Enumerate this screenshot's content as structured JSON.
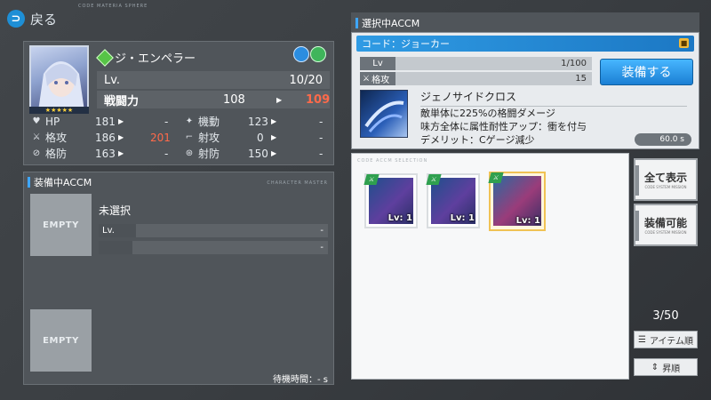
{
  "header": {
    "back_label": "戻る",
    "back_icon": "back-arrow-icon",
    "sub_caption": "CODE MATERIA SPHERE"
  },
  "character": {
    "name": "ジ・エンペラー",
    "stars": "★★★★★",
    "level_label": "Lv.",
    "level": "10/20",
    "power_label": "戦闘力",
    "power_current": "108",
    "power_new": "109",
    "arrow": "▶",
    "stats_left": [
      {
        "icon": "heart-icon",
        "label": "HP",
        "value": "181",
        "new": "-"
      },
      {
        "icon": "sword-icon",
        "label": "格攻",
        "value": "186",
        "new": "201"
      },
      {
        "icon": "shield-icon",
        "label": "格防",
        "value": "163",
        "new": "-"
      }
    ],
    "stats_right": [
      {
        "icon": "boot-icon",
        "label": "機動",
        "value": "123",
        "new": "-"
      },
      {
        "icon": "gun-icon",
        "label": "射攻",
        "value": "0",
        "new": "-"
      },
      {
        "icon": "guard-icon",
        "label": "射防",
        "value": "150",
        "new": "-"
      }
    ]
  },
  "equipped": {
    "title": "装備中ACCM",
    "slots": [
      {
        "empty_label": "EMPTY",
        "name": "未選択",
        "lv_label": "Lv.",
        "lv_value": "-",
        "extra_value": "-"
      },
      {
        "empty_label": "EMPTY"
      }
    ],
    "wait_time": "待機時間：- s",
    "corner_caption": "CHARACTER MASTER"
  },
  "selected": {
    "title": "選択中ACCM",
    "code": "コード：ジョーカー",
    "lv_label": "Lv",
    "lv_value": "1/100",
    "atk_label": "格攻",
    "atk_value": "15",
    "equip_button": "装備する",
    "skill_name": "ジェノサイドクロス",
    "skill_desc": [
      "敵単体に225%の格闘ダメージ",
      "味方全体に属性耐性アップ：衝を付与",
      "デメリット：Cゲージ減少"
    ],
    "cooldown": "60.0 s"
  },
  "list": {
    "caption": "CODE ACCM SELECTION",
    "cards": [
      {
        "lv": "Lv: 1",
        "selected": false
      },
      {
        "lv": "Lv: 1",
        "selected": false
      },
      {
        "lv": "Lv: 1",
        "selected": true
      }
    ]
  },
  "sidebar": {
    "show_all": "全て表示",
    "equippable": "装備可能",
    "caption": "CODE SYSTEM MISSION",
    "count": "3/50",
    "sort_by": "アイテム順",
    "order": "昇順"
  },
  "colors": {
    "accent": "#1e8fd6",
    "highlight": "#ff6a4a",
    "selected_border": "#f0c254"
  }
}
